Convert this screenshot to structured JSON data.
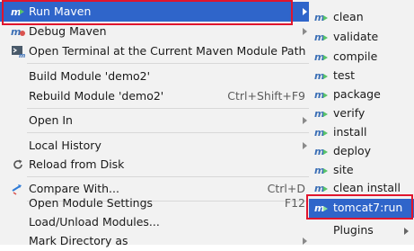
{
  "main_menu": {
    "items": [
      {
        "label": "Run Maven",
        "shortcut": "",
        "icon": "maven-run-icon",
        "submenu": true
      },
      {
        "label": "Debug Maven",
        "shortcut": "",
        "icon": "maven-debug-icon",
        "submenu": true
      },
      {
        "label": "Open Terminal at the Current Maven Module Path",
        "shortcut": "",
        "icon": "terminal-icon",
        "submenu": false
      },
      {
        "label": "Build Module 'demo2'",
        "shortcut": "",
        "icon": "",
        "submenu": false
      },
      {
        "label": "Rebuild Module 'demo2'",
        "shortcut": "Ctrl+Shift+F9",
        "icon": "",
        "submenu": false
      },
      {
        "label": "Open In",
        "shortcut": "",
        "icon": "",
        "submenu": true
      },
      {
        "label": "Local History",
        "shortcut": "",
        "icon": "",
        "submenu": true
      },
      {
        "label": "Reload from Disk",
        "shortcut": "",
        "icon": "reload-icon",
        "submenu": false
      },
      {
        "label": "Compare With...",
        "shortcut": "Ctrl+D",
        "icon": "compare-icon",
        "submenu": false
      },
      {
        "label": "Open Module Settings",
        "shortcut": "F12",
        "icon": "",
        "submenu": false
      },
      {
        "label": "Load/Unload Modules...",
        "shortcut": "",
        "icon": "",
        "submenu": false
      },
      {
        "label": "Mark Directory as",
        "shortcut": "",
        "icon": "",
        "submenu": true
      }
    ]
  },
  "submenu": {
    "items": [
      {
        "label": "clean"
      },
      {
        "label": "validate"
      },
      {
        "label": "compile"
      },
      {
        "label": "test"
      },
      {
        "label": "package"
      },
      {
        "label": "verify"
      },
      {
        "label": "install"
      },
      {
        "label": "deploy"
      },
      {
        "label": "site"
      },
      {
        "label": "clean install"
      },
      {
        "label": "tomcat7:run"
      },
      {
        "label": "Plugins"
      }
    ]
  },
  "colors": {
    "selection": "#2f65ca",
    "highlight_box": "#e0152d",
    "menu_background": "#f2f2f2"
  }
}
